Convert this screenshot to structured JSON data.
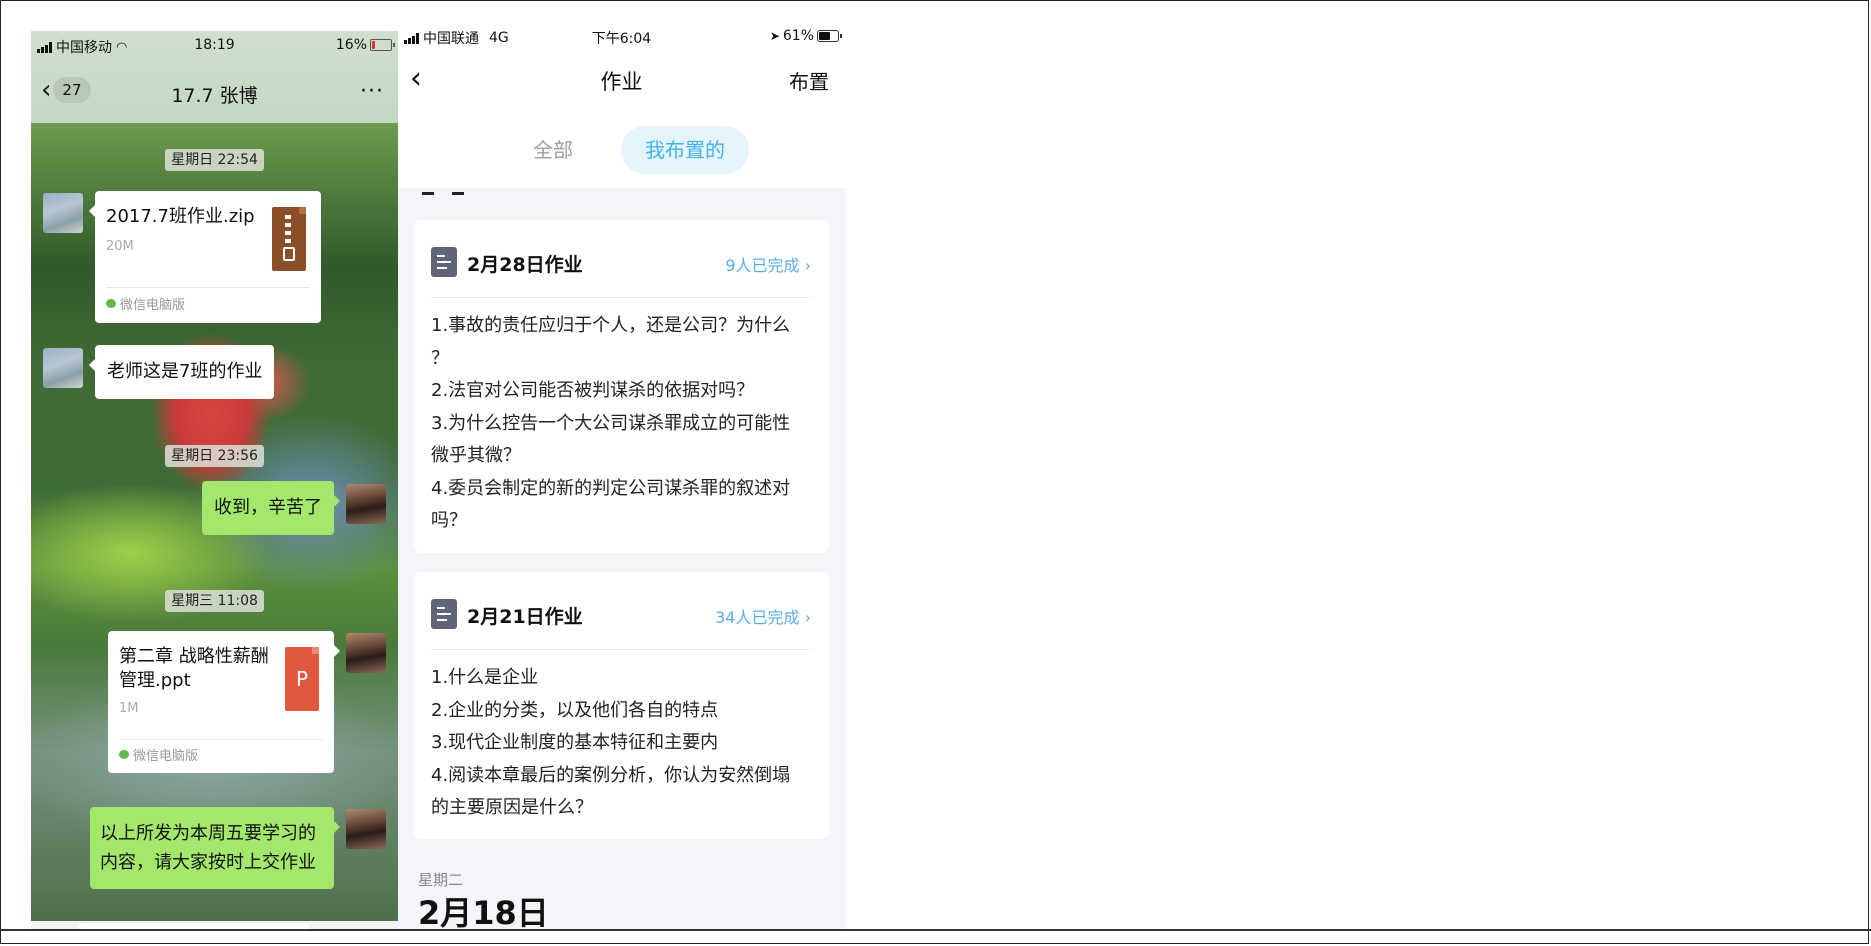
{
  "left_phone": {
    "status": {
      "carrier": "中国移动",
      "time": "18:19",
      "battery": "16%",
      "battery_level": 0.16
    },
    "nav": {
      "back_count": "27",
      "title": "17.7 张博",
      "more": "···"
    },
    "messages": {
      "time1": "星期日 22:54",
      "file1": {
        "name": "2017.7班作业.zip",
        "size": "20M",
        "source": "微信电脑版"
      },
      "text1": "老师这是7班的作业",
      "time2": "星期日 23:56",
      "reply1": "收到，辛苦了",
      "time3": "星期三 11:08",
      "file2": {
        "name": "第二章 战略性薪酬管理.ppt",
        "size": "1M",
        "source": "微信电脑版",
        "icon_letter": "P"
      },
      "reply2": "以上所发为本周五要学习的内容，请大家按时上交作业"
    }
  },
  "right_phone": {
    "status": {
      "carrier": "中国联通",
      "network": "4G",
      "time": "下午6:04",
      "battery": "61%"
    },
    "nav": {
      "back": "‹",
      "title": "作业",
      "action": "布置"
    },
    "tabs": {
      "all": "全部",
      "mine": "我布置的"
    },
    "cards": [
      {
        "title": "2月28日作业",
        "done": "9人已完成",
        "lines": [
          "1.事故的责任应归于个人，还是公司？为什么",
          "？",
          "2.法官对公司能否被判谋杀的依据对吗？",
          "3.为什么控告一个大公司谋杀罪成立的可能性",
          "微乎其微？",
          "4.委员会制定的新的判定公司谋杀罪的叙述对",
          "吗？"
        ]
      },
      {
        "title": "2月21日作业",
        "done": "34人已完成",
        "lines": [
          "1.什么是企业",
          "2.企业的分类，以及他们各自的特点",
          "3.现代企业制度的基本特征和主要内",
          "4.阅读本章最后的案例分析，你认为安然倒塌",
          "的主要原因是什么？"
        ]
      }
    ],
    "date_group": {
      "weekday": "星期二",
      "date": "2月18日"
    }
  },
  "colors": {
    "wechat_green": "#a3e86d",
    "accent_blue": "#3fb4e6",
    "done_blue": "#5aaee0"
  }
}
